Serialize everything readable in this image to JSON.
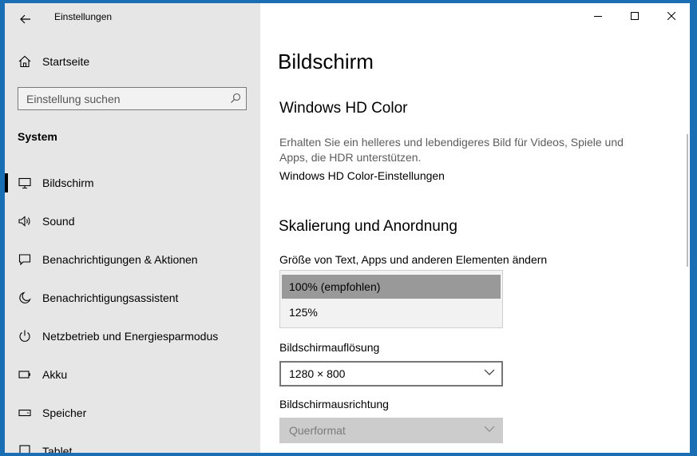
{
  "window": {
    "title": "Einstellungen",
    "caption": [
      "minimize",
      "maximize",
      "close"
    ]
  },
  "sidebar": {
    "home_label": "Startseite",
    "search_placeholder": "Einstellung suchen",
    "section_header": "System",
    "items": [
      {
        "label": "Bildschirm",
        "icon": "monitor-icon",
        "active": true
      },
      {
        "label": "Sound",
        "icon": "speaker-icon",
        "active": false
      },
      {
        "label": "Benachrichtigungen & Aktionen",
        "icon": "notification-icon",
        "active": false
      },
      {
        "label": "Benachrichtigungsassistent",
        "icon": "moon-icon",
        "active": false
      },
      {
        "label": "Netzbetrieb und Energiesparmodus",
        "icon": "power-icon",
        "active": false
      },
      {
        "label": "Akku",
        "icon": "battery-icon",
        "active": false
      },
      {
        "label": "Speicher",
        "icon": "storage-icon",
        "active": false
      },
      {
        "label": "Tablet",
        "icon": "tablet-icon",
        "active": false
      }
    ]
  },
  "main": {
    "page_title": "Bildschirm",
    "hdr": {
      "title": "Windows HD Color",
      "description": "Erhalten Sie ein helleres und lebendigeres Bild für Videos, Spiele und Apps, die HDR unterstützen.",
      "link": "Windows HD Color-Einstellungen"
    },
    "scaling": {
      "title": "Skalierung und Anordnung",
      "label": "Größe von Text, Apps und anderen Elementen ändern",
      "options": [
        "100% (empfohlen)",
        "125%"
      ],
      "selected": "100% (empfohlen)"
    },
    "resolution": {
      "label": "Bildschirmauflösung",
      "value": "1280 × 800"
    },
    "orientation": {
      "label": "Bildschirmausrichtung",
      "value": "Querformat"
    }
  },
  "colors": {
    "desktop": "#1a6fb4",
    "sidebar": "#e6e6e6",
    "selected_option": "#999999",
    "disabled_dropdown": "#cccccc"
  }
}
